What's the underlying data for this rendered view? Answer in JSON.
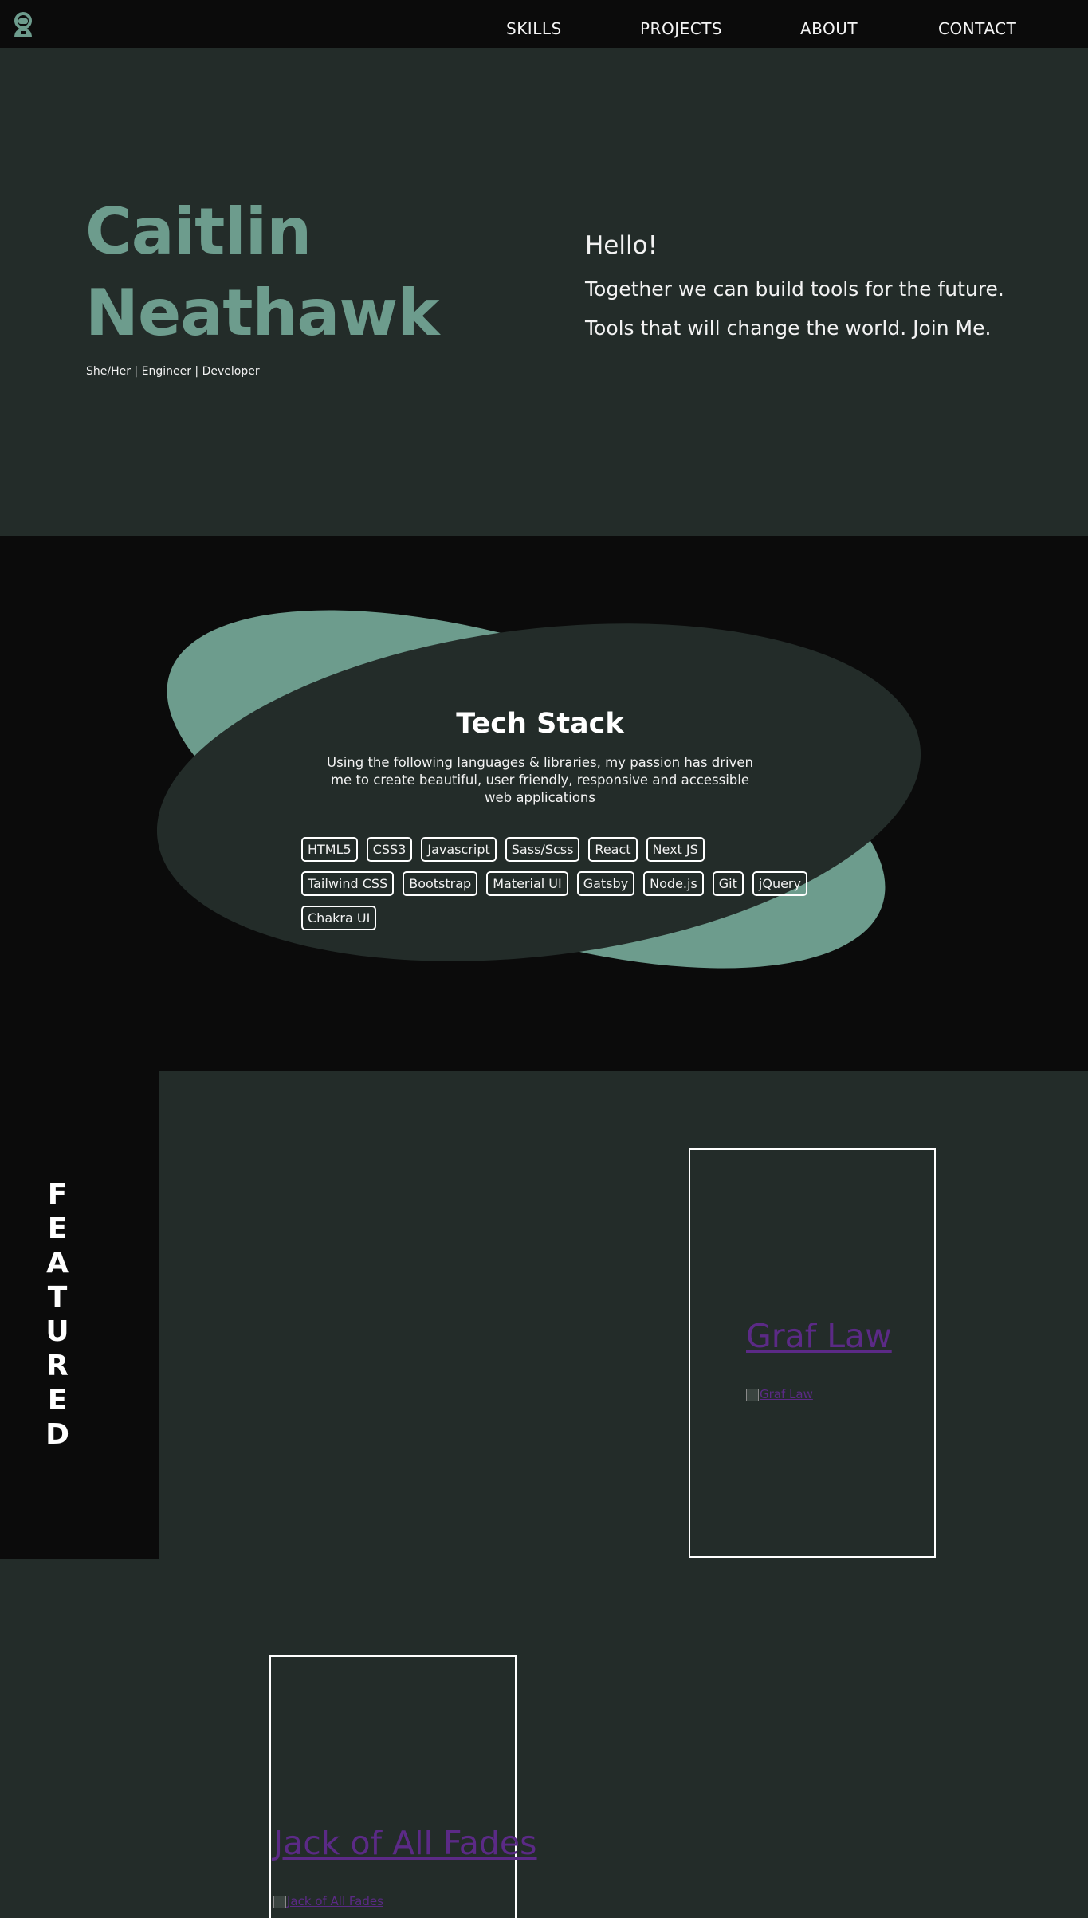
{
  "nav": {
    "logo_icon": "astronaut-icon",
    "links": [
      "SKILLS",
      "PROJECTS",
      "ABOUT",
      "CONTACT"
    ]
  },
  "hero": {
    "name_line1": "Caitlin",
    "name_line2": "Neathawk",
    "subtitle": "She/Her | Engineer | Developer",
    "hello": "Hello!",
    "line1": "Together we can build tools for the future.",
    "line2": "Tools that will change the world. Join Me."
  },
  "tech": {
    "title": "Tech Stack",
    "description": "Using the following languages & libraries, my passion has driven me to create beautiful, user friendly, responsive and accessible web applications",
    "skills": [
      "HTML5",
      "CSS3",
      "Javascript",
      "Sass/Scss",
      "React",
      "Next JS",
      "Tailwind CSS",
      "Bootstrap",
      "Material UI",
      "Gatsby",
      "Node.js",
      "Git",
      "jQuery",
      "Chakra UI"
    ]
  },
  "featured": {
    "label": "FEATURED",
    "projects": [
      {
        "title": "Graf Law",
        "image_alt": "Graf Law"
      },
      {
        "title": "Jack of All Fades",
        "image_alt": "Jack of All Fades"
      }
    ]
  },
  "colors": {
    "accent": "#6d9c8d",
    "background": "#232c29",
    "dark": "#0b0b0b",
    "link": "#5b2a86"
  }
}
